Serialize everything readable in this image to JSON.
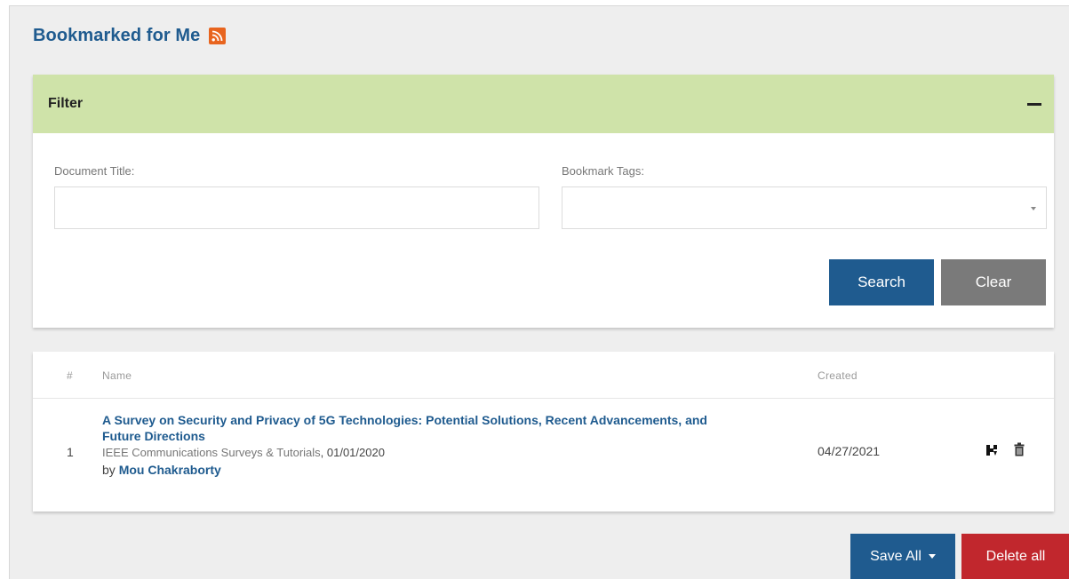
{
  "header": {
    "title": "Bookmarked for Me",
    "rss_icon": "rss-feed-icon",
    "rss_color": "#e8641e"
  },
  "filter": {
    "title": "Filter",
    "collapse_icon": "minus-icon",
    "document_title_label": "Document Title:",
    "document_title_value": "",
    "bookmark_tags_label": "Bookmark Tags:",
    "bookmark_tags_value": "",
    "search_label": "Search",
    "clear_label": "Clear",
    "header_color": "#cfe3a9"
  },
  "table": {
    "columns": {
      "num": "#",
      "name": "Name",
      "created": "Created"
    },
    "rows": [
      {
        "num": "1",
        "title": "A Survey on Security and Privacy of 5G Technologies: Potential Solutions, Recent Advancements, and Future Directions",
        "journal": "IEEE Communications Surveys & Tutorials",
        "pub_date": ", 01/01/2020",
        "by": "by ",
        "author": "Mou Chakraborty",
        "created": "04/27/2021",
        "actions": [
          "save-icon",
          "trash-icon"
        ]
      }
    ]
  },
  "footer": {
    "save_all_label": "Save All",
    "delete_all_label": "Delete all"
  },
  "colors": {
    "brand_blue": "#1f5b8f",
    "clear_gray": "#7a7a7a",
    "danger_red": "#c1272d",
    "page_bg": "#eeeeee"
  }
}
